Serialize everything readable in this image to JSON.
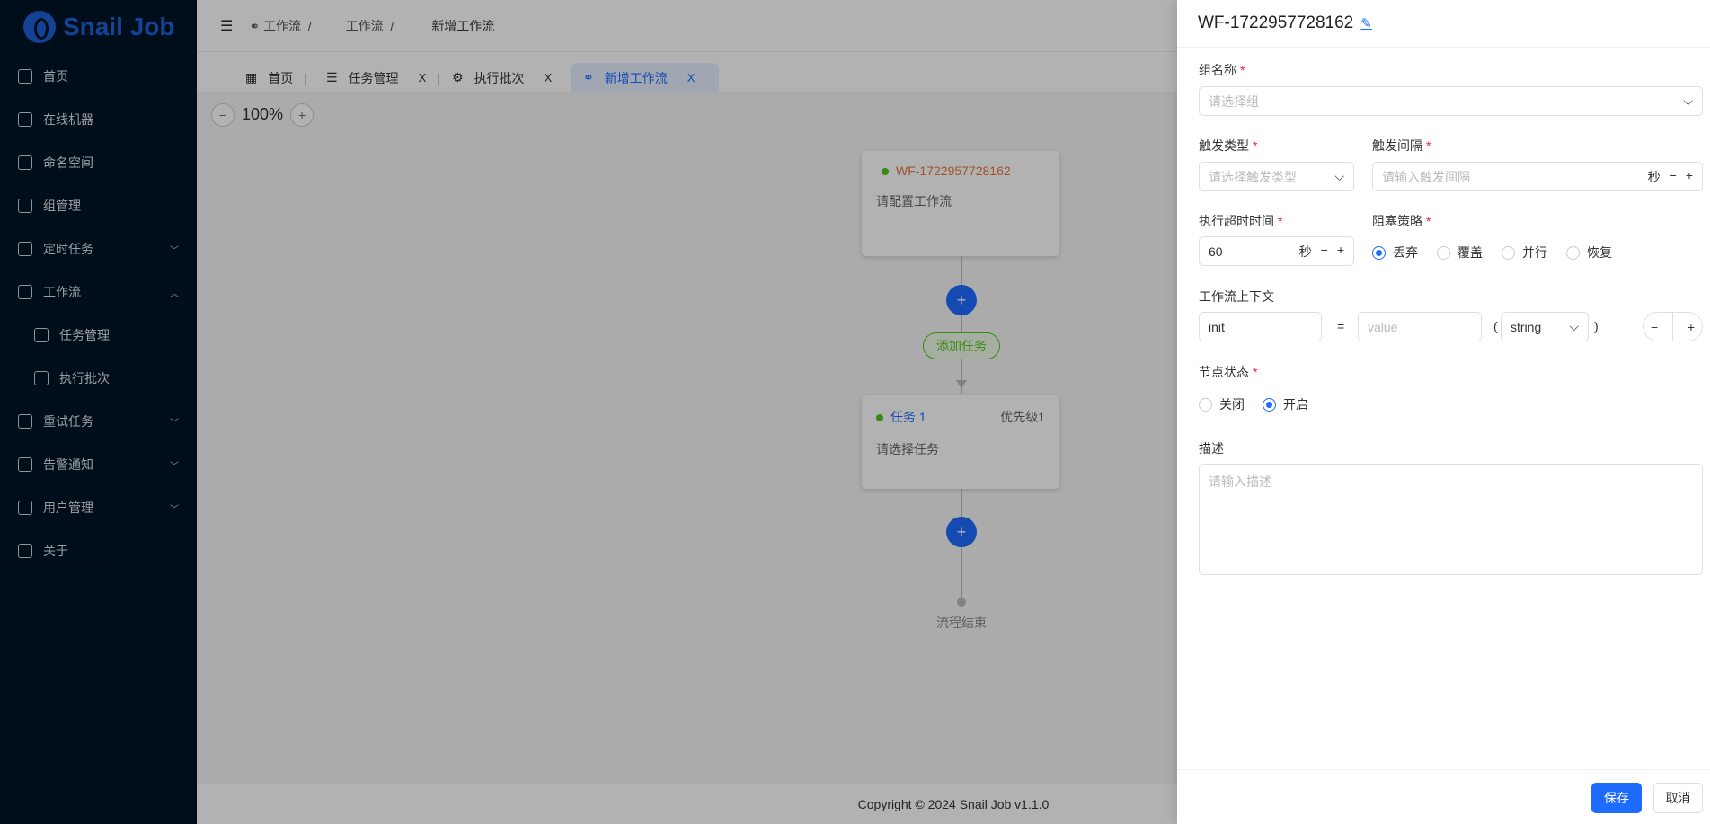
{
  "app": {
    "name": "Snail Job",
    "brand_color": "#1d5fd6"
  },
  "sidebar": {
    "items": [
      {
        "label": "首页",
        "icon": "dashboard-icon"
      },
      {
        "label": "在线机器",
        "icon": "server-icon"
      },
      {
        "label": "命名空间",
        "icon": "namespace-icon"
      },
      {
        "label": "组管理",
        "icon": "group-icon"
      },
      {
        "label": "定时任务",
        "icon": "timer-icon",
        "expandable": true
      },
      {
        "label": "工作流",
        "icon": "workflow-icon",
        "expandable": true,
        "expanded": true
      },
      {
        "label": "任务管理",
        "icon": "task-list-icon",
        "sub": true
      },
      {
        "label": "执行批次",
        "icon": "batch-icon",
        "sub": true
      },
      {
        "label": "重试任务",
        "icon": "retry-icon",
        "expandable": true
      },
      {
        "label": "告警通知",
        "icon": "bell-icon",
        "expandable": true
      },
      {
        "label": "用户管理",
        "icon": "user-icon",
        "expandable": true
      },
      {
        "label": "关于",
        "icon": "help-icon"
      }
    ]
  },
  "breadcrumb": [
    "工作流",
    "工作流",
    "新增工作流"
  ],
  "tabs": [
    {
      "label": "首页"
    },
    {
      "label": "任务管理",
      "close": "X"
    },
    {
      "label": "执行批次",
      "close": "X"
    },
    {
      "label": "新增工作流",
      "close": "X",
      "active": true
    }
  ],
  "toolbar": {
    "zoom": "100%"
  },
  "canvas": {
    "start_node": {
      "title": "WF-1722957728162",
      "desc": "请配置工作流"
    },
    "add_task": "添加任务",
    "task_node": {
      "title": "任务 1",
      "priority": "优先级1",
      "desc": "请选择任务"
    },
    "end_label": "流程结束"
  },
  "footer": {
    "copyright": "Copyright © 2024 Snail Job v1.1.0"
  },
  "drawer": {
    "title": "WF-1722957728162",
    "group": {
      "label": "组名称",
      "placeholder": "请选择组"
    },
    "trigger_type": {
      "label": "触发类型",
      "placeholder": "请选择触发类型"
    },
    "trigger_interval": {
      "label": "触发间隔",
      "placeholder": "请输入触发间隔",
      "unit": "秒"
    },
    "timeout": {
      "label": "执行超时时间",
      "value": "60",
      "unit": "秒"
    },
    "block_strategy": {
      "label": "阻塞策略",
      "options": [
        "丢弃",
        "覆盖",
        "并行",
        "恢复"
      ],
      "selected": "丢弃"
    },
    "context": {
      "label": "工作流上下文",
      "key": "init",
      "eq": "=",
      "value_placeholder": "value",
      "type": "string",
      "lp": "(",
      "rp": ")"
    },
    "node_status": {
      "label": "节点状态",
      "options": [
        "关闭",
        "开启"
      ],
      "selected": "开启"
    },
    "description": {
      "label": "描述",
      "placeholder": "请输入描述"
    },
    "save": "保存",
    "cancel": "取消"
  },
  "colors": {
    "primary": "#1d6bff",
    "success": "#52c41a",
    "sidebar_bg": "#001529",
    "start_title": "#e5783e"
  }
}
